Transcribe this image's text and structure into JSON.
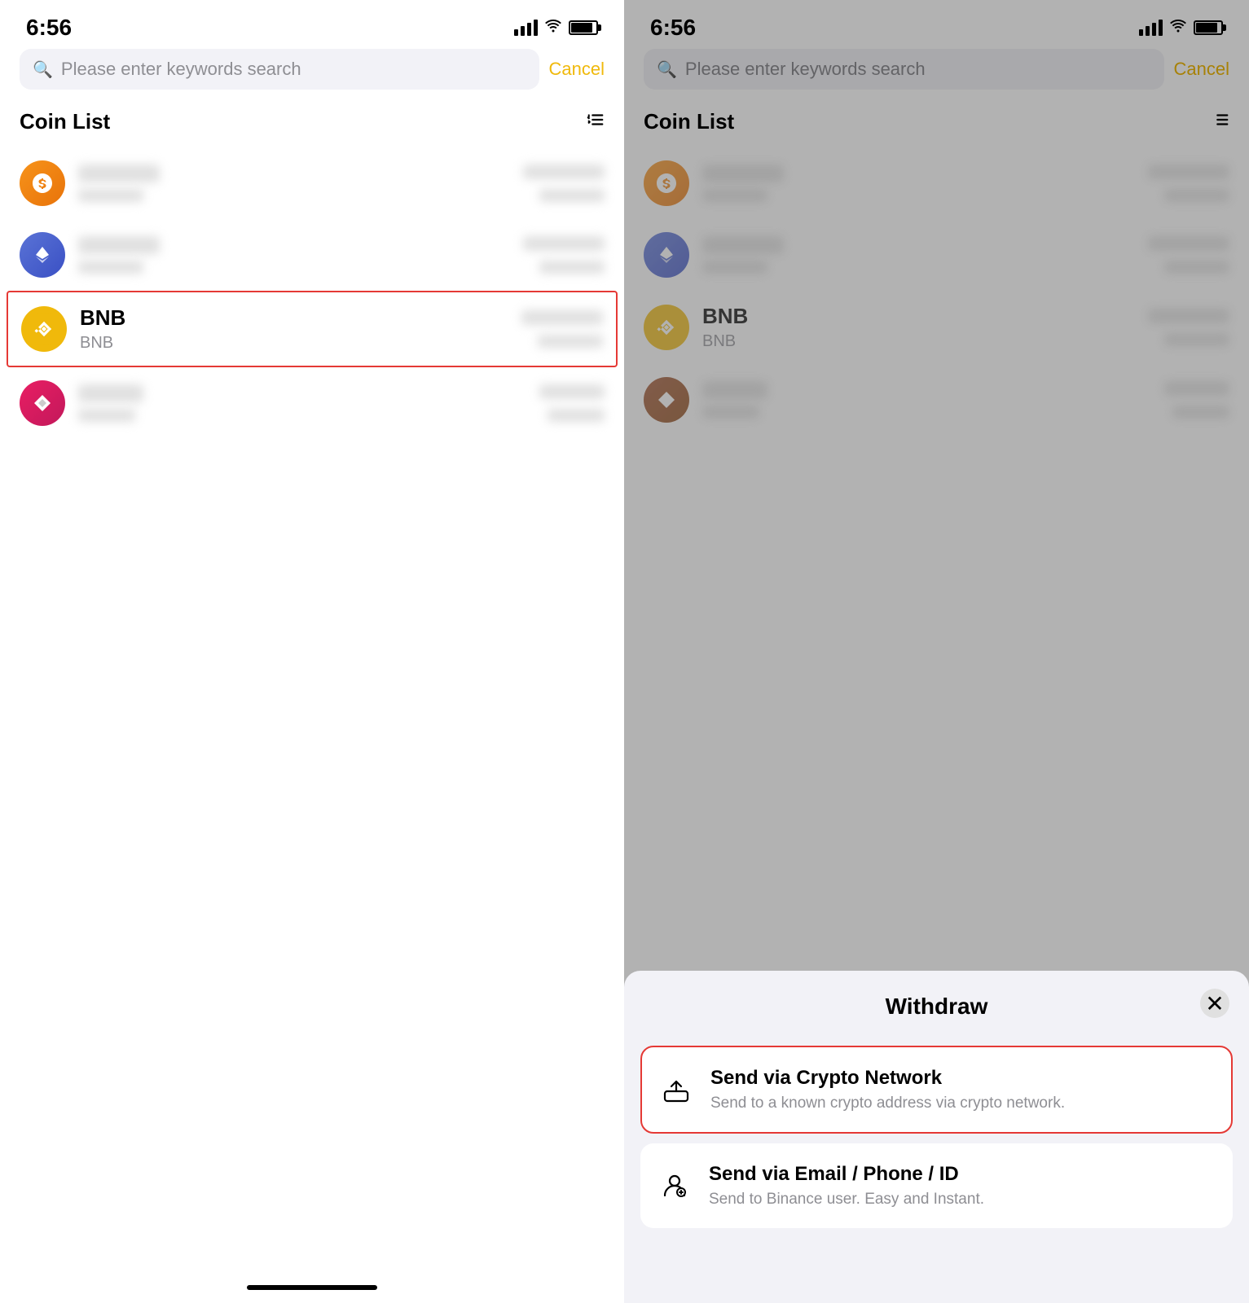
{
  "left": {
    "status": {
      "time": "6:56"
    },
    "search": {
      "placeholder": "Please enter keywords search",
      "cancel_label": "Cancel"
    },
    "coin_list": {
      "title": "Coin List",
      "sort_icon": "↕"
    },
    "coins": [
      {
        "id": "coin1",
        "name": "",
        "symbol": "",
        "color": "orange",
        "letter": "₿",
        "highlighted": false
      },
      {
        "id": "coin2",
        "name": "",
        "symbol": "",
        "color": "blue",
        "letter": "Ξ",
        "highlighted": false
      },
      {
        "id": "bnb",
        "name": "BNB",
        "symbol": "BNB",
        "color": "bnb",
        "letter": "BNB",
        "highlighted": true
      },
      {
        "id": "coin4",
        "name": "",
        "symbol": "",
        "color": "pink",
        "letter": "♦",
        "highlighted": false
      }
    ]
  },
  "right": {
    "status": {
      "time": "6:56"
    },
    "search": {
      "placeholder": "Please enter keywords search",
      "cancel_label": "Cancel"
    },
    "coin_list": {
      "title": "Coin List",
      "sort_icon": "↕"
    },
    "bottom_sheet": {
      "title": "Withdraw",
      "close_label": "×",
      "options": [
        {
          "id": "crypto-network",
          "title": "Send via Crypto Network",
          "description": "Send to a known crypto address via crypto network.",
          "highlighted": true
        },
        {
          "id": "email-phone",
          "title": "Send via Email / Phone / ID",
          "description": "Send to Binance user. Easy and Instant.",
          "highlighted": false
        }
      ]
    }
  }
}
